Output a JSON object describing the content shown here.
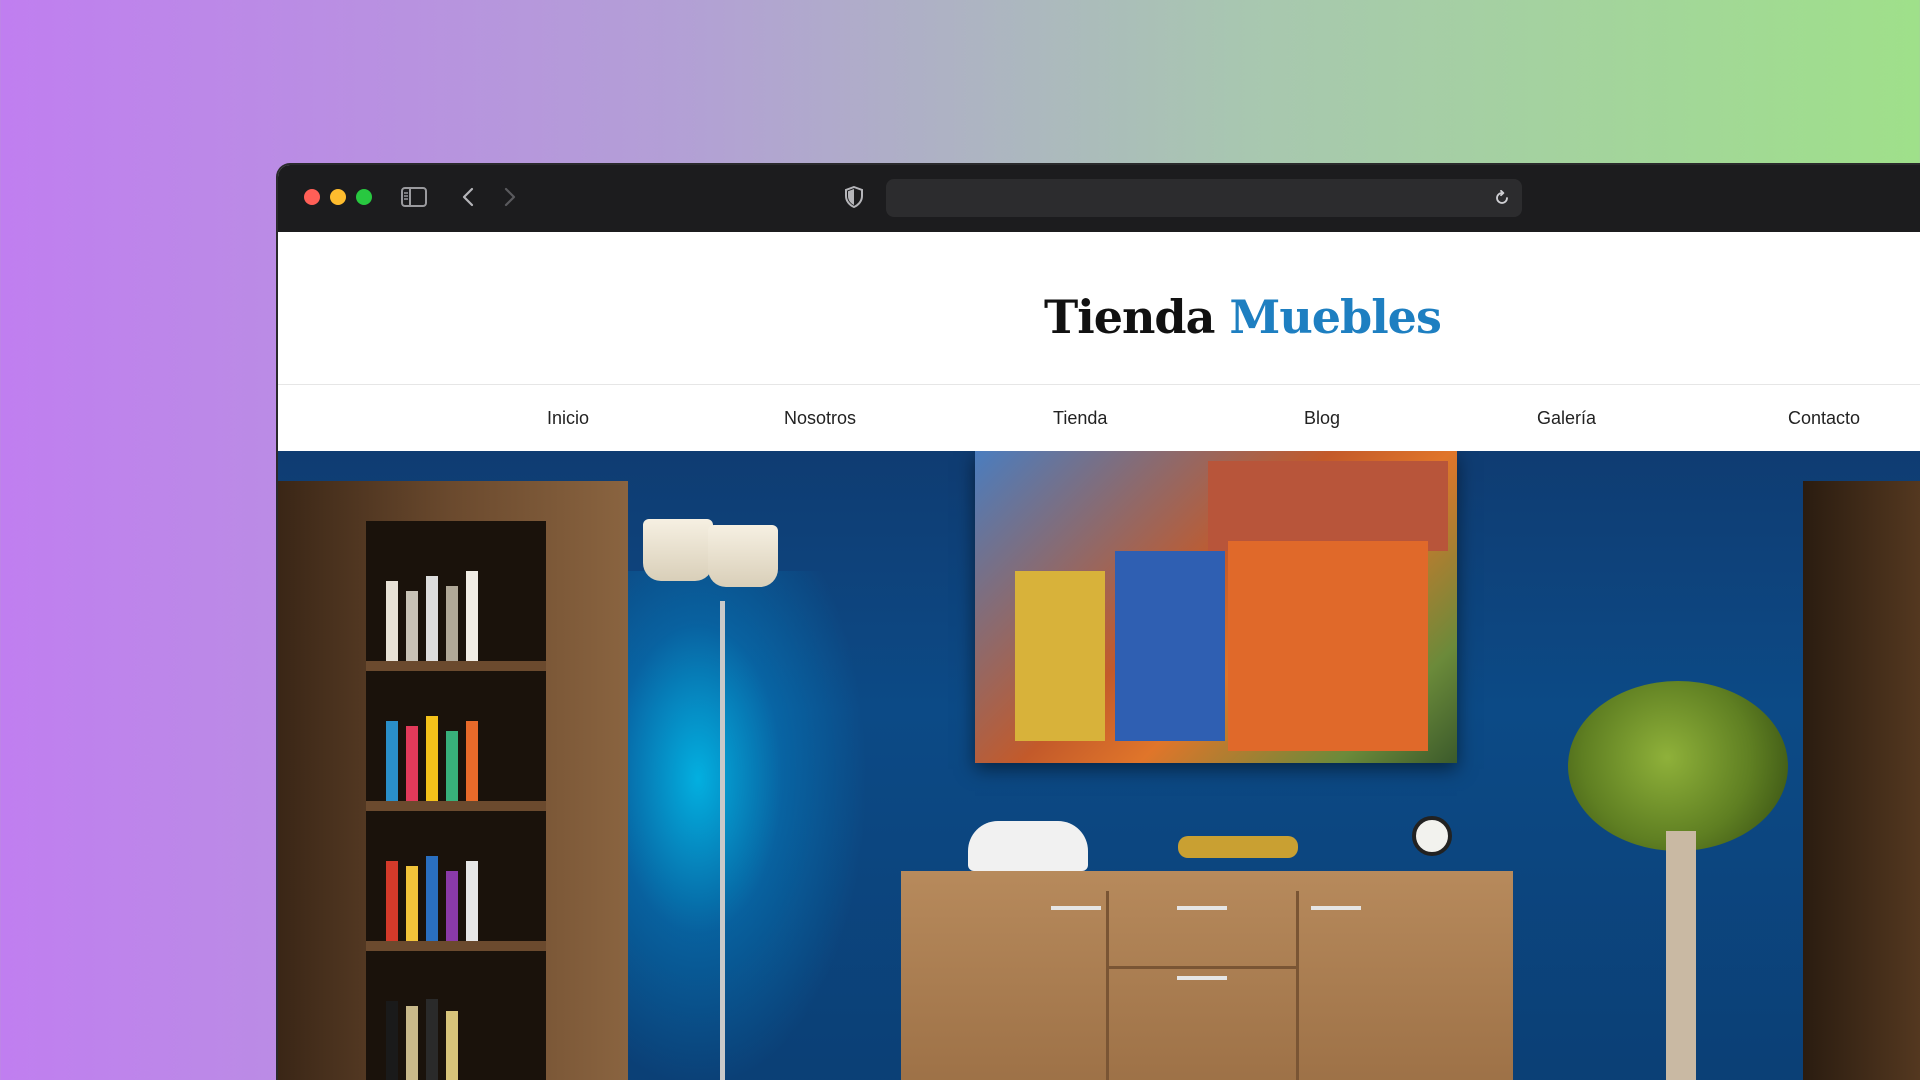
{
  "browser": {
    "url": "",
    "icons": {
      "sidebar": "sidebar-toggle-icon",
      "back": "chevron-left-icon",
      "forward": "chevron-right-icon",
      "privacy": "shield-icon",
      "reload": "reload-icon"
    }
  },
  "site": {
    "brand_primary": "Tienda",
    "brand_accent": "Muebles",
    "accent_color": "#1e7fc1",
    "nav": [
      {
        "label": "Inicio"
      },
      {
        "label": "Nosotros"
      },
      {
        "label": "Tienda"
      },
      {
        "label": "Blog"
      },
      {
        "label": "Galería"
      },
      {
        "label": "Contacto"
      }
    ]
  }
}
